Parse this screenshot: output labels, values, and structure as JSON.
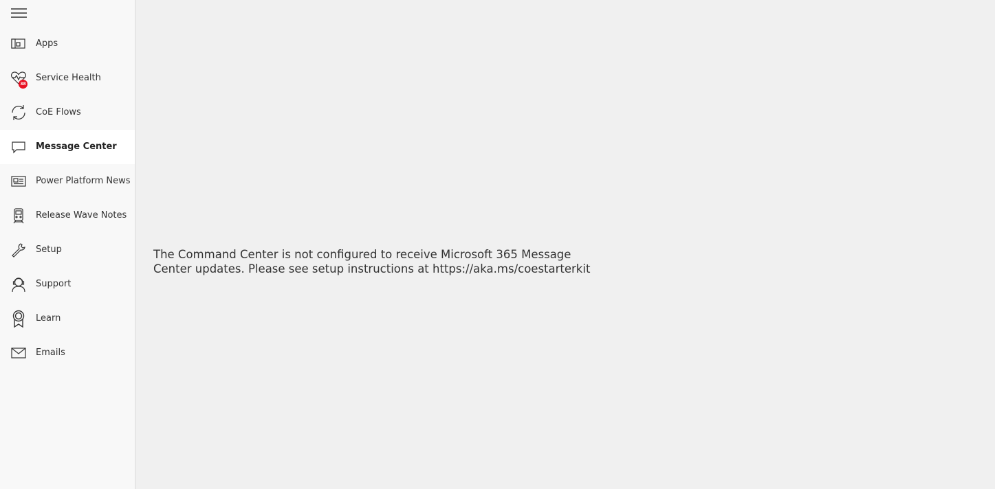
{
  "sidebar": {
    "menu_icon": "hamburger-menu-icon",
    "items": [
      {
        "label": "Apps",
        "icon": "apps-icon",
        "selected": false
      },
      {
        "label": "Service Health",
        "icon": "heart-pulse-icon",
        "selected": false,
        "badge": "38"
      },
      {
        "label": "CoE Flows",
        "icon": "refresh-flow-icon",
        "selected": false
      },
      {
        "label": "Message Center",
        "icon": "message-icon",
        "selected": true
      },
      {
        "label": "Power Platform News",
        "icon": "news-icon",
        "selected": false
      },
      {
        "label": "Release Wave Notes",
        "icon": "train-icon",
        "selected": false
      },
      {
        "label": "Setup",
        "icon": "wrench-icon",
        "selected": false
      },
      {
        "label": "Support",
        "icon": "support-agent-icon",
        "selected": false
      },
      {
        "label": "Learn",
        "icon": "ribbon-award-icon",
        "selected": false
      },
      {
        "label": "Emails",
        "icon": "mail-icon",
        "selected": false
      }
    ]
  },
  "main": {
    "message": "The Command Center is not configured to receive Microsoft 365 Message Center updates. Please see setup instructions at https://aka.ms/coestarterkit"
  },
  "colors": {
    "badge": "#e81123",
    "sidebar_bg": "#f8f8f8",
    "main_bg": "#f0f0f0",
    "selected_bg": "#ffffff"
  }
}
